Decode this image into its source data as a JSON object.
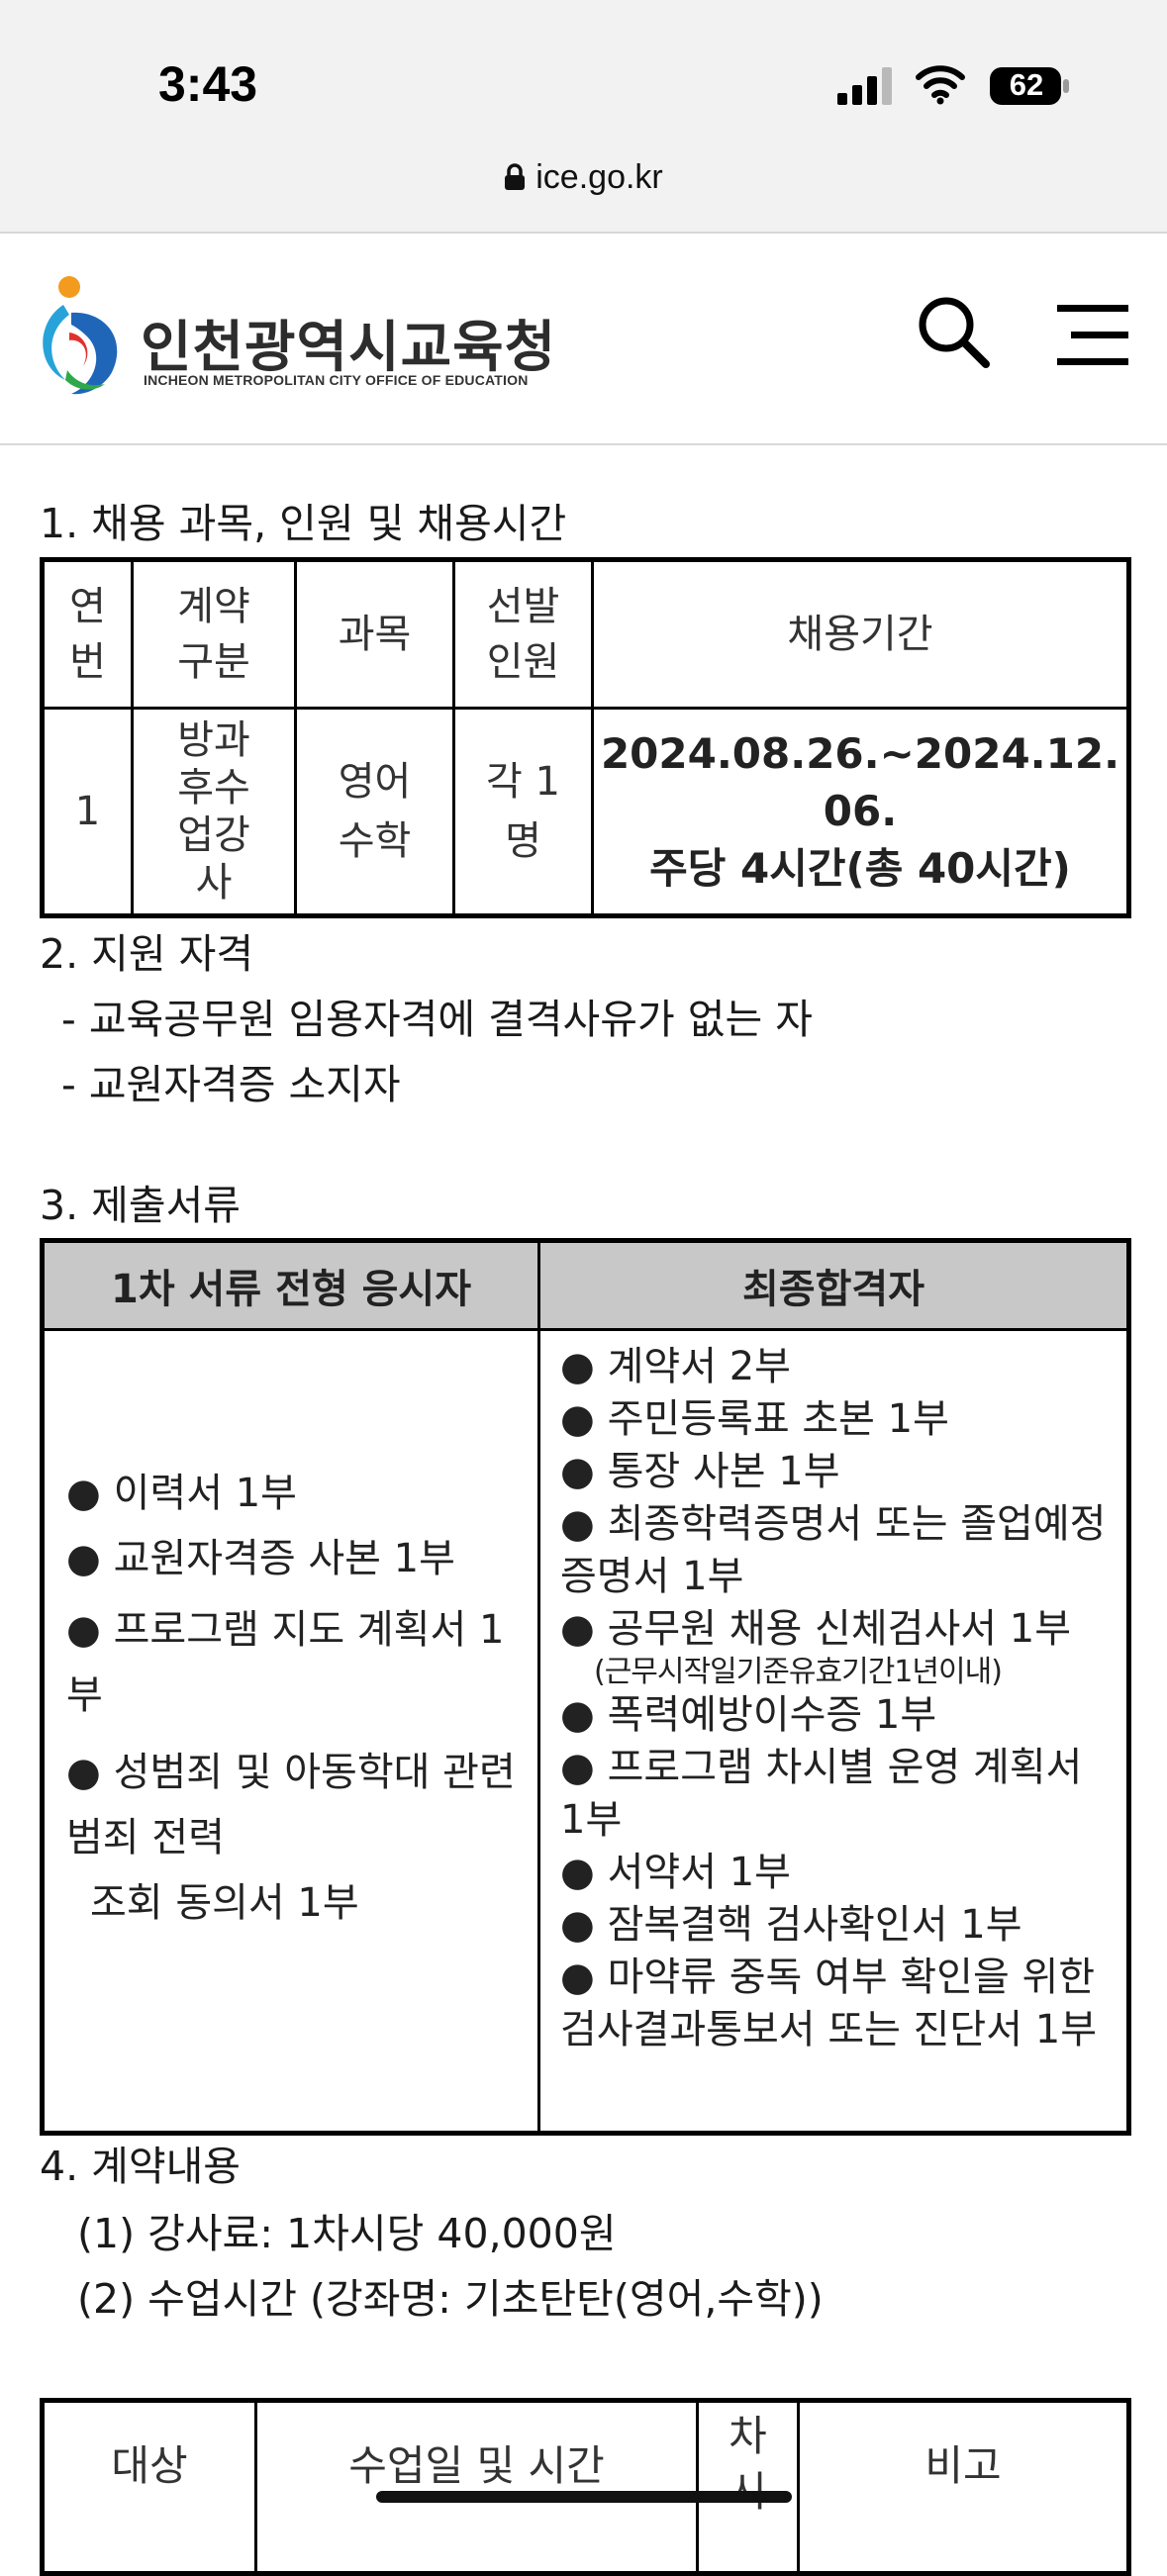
{
  "status_bar": {
    "time": "3:43",
    "battery_level": "62",
    "url": "ice.go.kr",
    "icons": [
      "signal-icon",
      "wifi-icon",
      "battery-icon",
      "lock-icon"
    ]
  },
  "header": {
    "org_name": "인천광역시교육청",
    "org_name_en": "INCHEON METROPOLITAN CITY OFFICE OF EDUCATION",
    "icons": [
      "search-icon",
      "menu-icon"
    ]
  },
  "section1": {
    "heading": "1. 채용 과목, 인원 및 채용시간",
    "table": {
      "headers": [
        "연\n번",
        "계약\n구분",
        "과목",
        "선발\n인원",
        "채용기간"
      ],
      "row": {
        "no": "1",
        "contract": "방과\n후수\n업강\n사",
        "subject": "영어\n수학",
        "count": "각 1\n명",
        "period_line1": "2024.08.26.~2024.12.",
        "period_line2": "06.",
        "period_line3": "주당 4시간(총 40시간)"
      }
    }
  },
  "section2": {
    "heading": "2. 지원 자격",
    "items": [
      "- 교육공무원 임용자격에 결격사유가 없는 자",
      "- 교원자격증 소지자"
    ]
  },
  "section3": {
    "heading": "3. 제출서류",
    "col_headers": [
      "1차 서류 전형 응시자",
      "최종합격자"
    ],
    "first_round": [
      "● 이력서 1부",
      "● 교원자격증 사본 1부",
      "● 프로그램 지도 계획서 1부",
      "● 성범죄 및 아동학대 관련 범죄 전력",
      "조회 동의서 1부"
    ],
    "final": [
      "● 계약서 2부",
      "● 주민등록표 초본 1부",
      "● 통장 사본 1부",
      "● 최종학력증명서 또는 졸업예정증명서 1부",
      "● 공무원 채용 신체검사서 1부",
      "(근무시작일기준유효기간1년이내)",
      "● 폭력예방이수증 1부",
      "● 프로그램 차시별 운영 계획서 1부",
      "● 서약서 1부",
      "● 잠복결핵 검사확인서 1부",
      "● 마약류 중독 여부 확인을 위한 검사결과통보서 또는 진단서 1부"
    ]
  },
  "section4": {
    "heading": "4. 계약내용",
    "items": [
      "(1) 강사료: 1차시당 40,000원",
      "(2) 수업시간 (강좌명: 기초탄탄(영어,수학))"
    ],
    "schedule_headers": [
      "대상",
      "수업일 및 시간",
      "차\n시",
      "비고"
    ]
  }
}
